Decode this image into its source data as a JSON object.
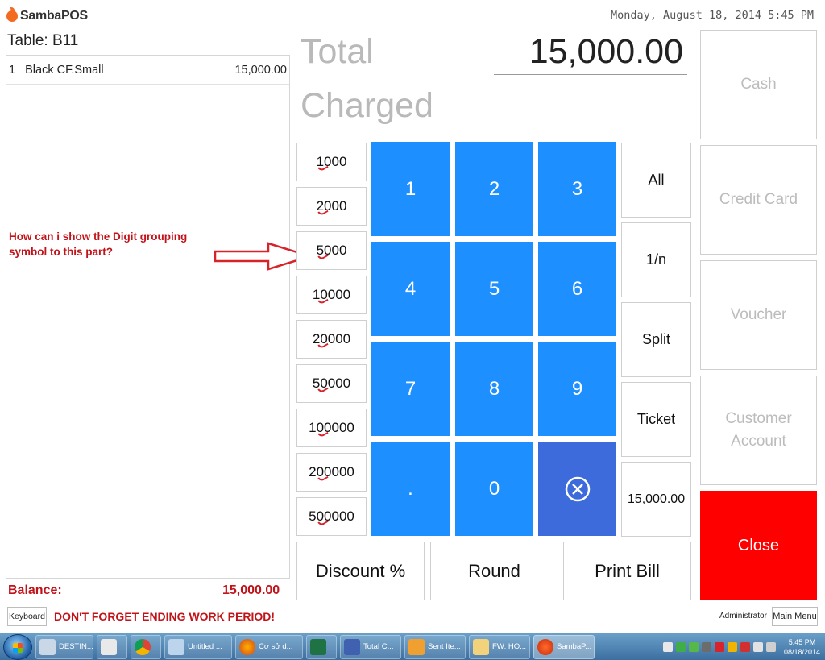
{
  "app": {
    "logo_text": "SambaPOS"
  },
  "header": {
    "datetime": "Monday, August 18, 2014 5:45 PM"
  },
  "ticket": {
    "table_title": "Table: B11",
    "lines": [
      {
        "qty": "1",
        "name": "Black CF.Small",
        "price": "15,000.00"
      }
    ],
    "balance_label": "Balance:",
    "balance_value": "15,000.00"
  },
  "annotation": {
    "text": "How can i show the Digit grouping symbol to this part?"
  },
  "footer": {
    "keyboard_label": "Keyboard",
    "warning": "DON'T FORGET ENDING WORK PERIOD!",
    "user": "Administrator",
    "main_menu_label": "Main Menu"
  },
  "payment": {
    "total_label": "Total",
    "charged_label": "Charged",
    "total_value": "15,000.00",
    "charged_value": ""
  },
  "amount_buttons": [
    "1000",
    "2000",
    "5000",
    "10000",
    "20000",
    "50000",
    "100000",
    "200000",
    "500000"
  ],
  "numpad": [
    "1",
    "2",
    "3",
    "4",
    "5",
    "6",
    "7",
    "8",
    "9",
    ".",
    "0"
  ],
  "side_buttons": [
    "All",
    "1/n",
    "Split",
    "Ticket",
    "15,000.00"
  ],
  "bottom_buttons": [
    "Discount %",
    "Round",
    "Print Bill"
  ],
  "payment_methods": [
    "Cash",
    "Credit Card",
    "Voucher",
    "Customer Account"
  ],
  "close_label": "Close",
  "colors": {
    "numpad": "#1e8fff",
    "backspace": "#3d6bdb",
    "close": "#ff0000",
    "alert_text": "#c0141a"
  },
  "taskbar": {
    "tasks": [
      "",
      "DESTIN...",
      "",
      "",
      "Untitled ...",
      "Cơ sở d...",
      "",
      "Total C...",
      "Sent Ite...",
      "FW: HO...",
      "SambaP..."
    ],
    "clock_time": "5:45 PM",
    "clock_date": "08/18/2014"
  }
}
